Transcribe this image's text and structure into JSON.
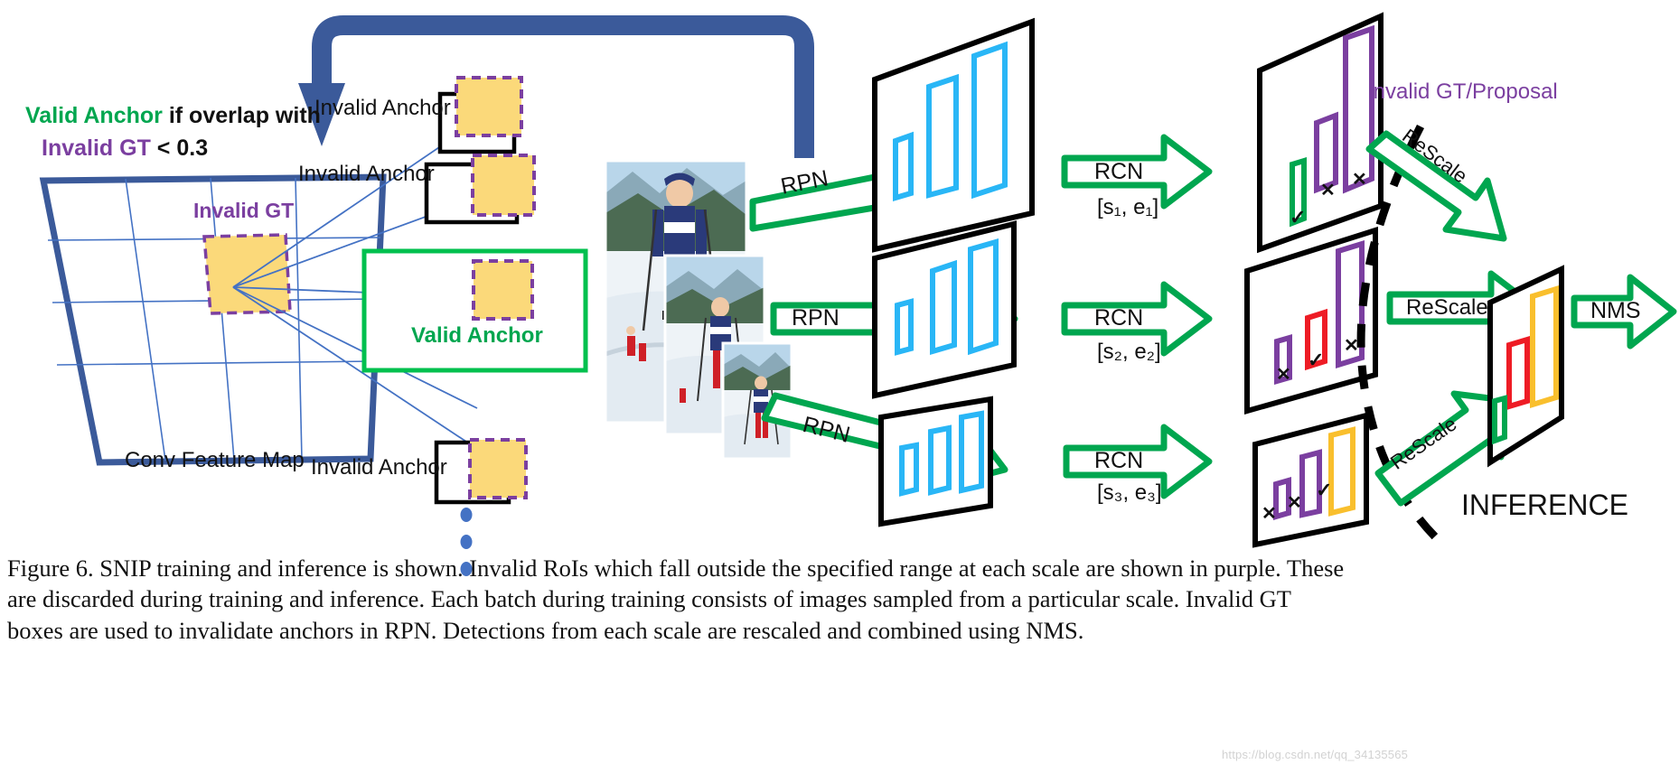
{
  "figure": {
    "id": "figure-6",
    "caption_lines": [
      "Figure 6. SNIP training and inference is shown. Invalid RoIs which fall outside the specified range at each scale are shown in purple. These",
      "are discarded during training and inference.  Each batch during training consists of images sampled from a particular scale.  Invalid GT",
      "boxes are used to invalidate anchors in RPN. Detections from each scale are rescaled and combined using NMS."
    ],
    "watermark": "https://blog.csdn.net/qq_34135565"
  },
  "colors": {
    "green": "#00a64f",
    "purple": "#7b3fa0",
    "blue_navy": "#3b5a9a",
    "blue_line": "#4472c4",
    "cyan": "#29b6f6",
    "yellow_fill": "#fbd97a",
    "yellow_box": "#f9bf2d",
    "red": "#ee1c25",
    "black": "#000000"
  },
  "left_panel": {
    "rule_line1_a": "Valid Anchor",
    "rule_line1_b": " if overlap with",
    "rule_line2_a": "Invalid GT",
    "rule_line2_b": " < 0.3",
    "feature_map_label": "Conv Feature Map",
    "invalid_gt_label": "Invalid GT",
    "anchors": [
      {
        "label": "Invalid Anchor",
        "type": "invalid"
      },
      {
        "label": "Invalid Anchor",
        "type": "invalid"
      },
      {
        "label": "Valid Anchor",
        "type": "valid"
      },
      {
        "label": "Invalid Anchor",
        "type": "invalid"
      }
    ],
    "ellipsis": "⋮"
  },
  "pipeline": {
    "rpn_label": "RPN",
    "rcn_label": "RCN",
    "rescale_label": "ReScale",
    "nms_label": "NMS",
    "inference_label": "INFERENCE",
    "invalid_gt_proposal_label": "Invalid GT/Proposal",
    "rows": [
      {
        "scale": 1,
        "range_label": "[s₁, e₁]",
        "rpn": "RPN",
        "rcn": "RCN",
        "proposal_boxes": [
          {
            "color": "cyan",
            "size": "small"
          },
          {
            "color": "cyan",
            "size": "medium"
          },
          {
            "color": "cyan",
            "size": "large"
          }
        ],
        "rcn_boxes": [
          {
            "color": "green",
            "mark": "✓"
          },
          {
            "color": "purple",
            "mark": "✕"
          },
          {
            "color": "purple",
            "mark": "✕"
          }
        ]
      },
      {
        "scale": 2,
        "range_label": "[s₂, e₂]",
        "rpn": "RPN",
        "rcn": "RCN",
        "proposal_boxes": [
          {
            "color": "cyan",
            "size": "small"
          },
          {
            "color": "cyan",
            "size": "medium"
          },
          {
            "color": "cyan",
            "size": "large"
          }
        ],
        "rcn_boxes": [
          {
            "color": "purple",
            "mark": "✕"
          },
          {
            "color": "red",
            "mark": "✓"
          },
          {
            "color": "purple",
            "mark": "✕"
          }
        ]
      },
      {
        "scale": 3,
        "range_label": "[s₃, e₃]",
        "rpn": "RPN",
        "rcn": "RCN",
        "proposal_boxes": [
          {
            "color": "cyan",
            "size": "small"
          },
          {
            "color": "cyan",
            "size": "medium"
          },
          {
            "color": "cyan",
            "size": "large"
          }
        ],
        "rcn_boxes": [
          {
            "color": "purple",
            "mark": "✕"
          },
          {
            "color": "purple",
            "mark": "✕"
          },
          {
            "color": "yellow",
            "mark": "✓"
          }
        ]
      }
    ],
    "final_boxes": [
      {
        "color": "green"
      },
      {
        "color": "red"
      },
      {
        "color": "yellow"
      }
    ]
  },
  "photo": {
    "alt": "skier-image-pyramid",
    "count": 3
  }
}
